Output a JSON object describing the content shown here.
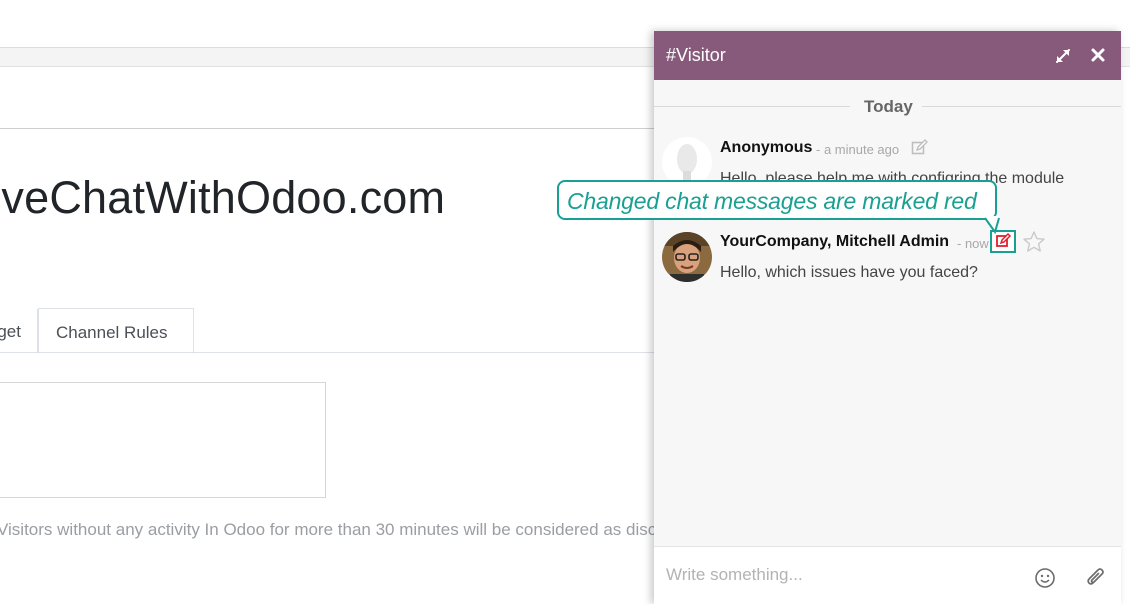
{
  "form": {
    "title": "LiveChatWithOdoo.com",
    "tabs": [
      {
        "label": "Widget"
      },
      {
        "label": "Channel Rules"
      }
    ],
    "help_text": "Visitors without any activity In Odoo for more than 30 minutes will be considered as disconnected."
  },
  "chat": {
    "title": "#Visitor",
    "header_icons": [
      "expand-icon",
      "close-icon"
    ],
    "day_separator": "Today",
    "messages": [
      {
        "author": "Anonymous",
        "time": "- a minute ago",
        "body": "Hello, please help me with configring the module",
        "edit_icon": "edit-icon",
        "edit_state": "unchanged"
      },
      {
        "author": "YourCompany, Mitchell Admin",
        "time": "- now",
        "body": "Hello, which issues have you faced?",
        "edit_icon": "edit-icon",
        "edit_state": "changed"
      }
    ],
    "composer": {
      "placeholder": "Write something...",
      "icons": [
        "emoji-icon",
        "attachment-icon"
      ]
    }
  },
  "annotation": {
    "callout": "Changed chat messages are marked red"
  },
  "colors": {
    "header": "#875a7b",
    "annotation": "#1aa092",
    "changed_edit_icon": "#e0202d"
  }
}
